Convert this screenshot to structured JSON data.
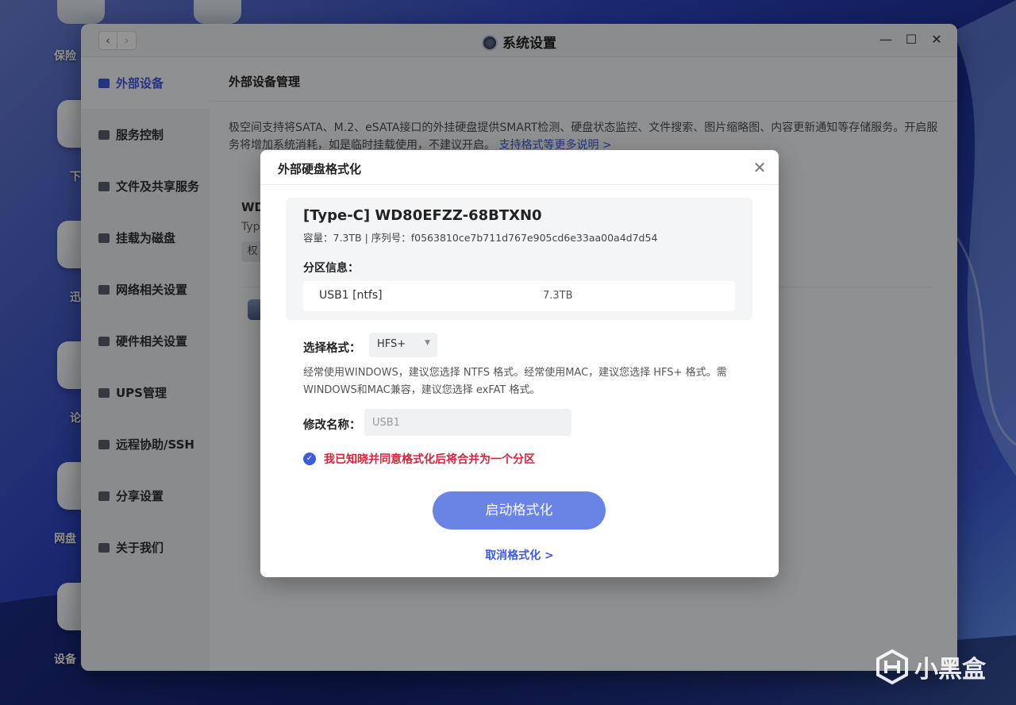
{
  "desktop": {
    "labels": [
      "保险",
      "下",
      "迅",
      "论",
      "网盘",
      "设备"
    ]
  },
  "window": {
    "title": "系统设置",
    "nav_back": "‹",
    "nav_forward": "›",
    "ctrl_min": "—",
    "ctrl_max": "☐",
    "ctrl_close": "✕"
  },
  "sidebar": {
    "items": [
      {
        "label": "外部设备",
        "icon": "device-icon"
      },
      {
        "label": "服务控制",
        "icon": "toggle-icon"
      },
      {
        "label": "文件及共享服务",
        "icon": "file-icon"
      },
      {
        "label": "挂载为磁盘",
        "icon": "disk-icon"
      },
      {
        "label": "网络相关设置",
        "icon": "globe-icon"
      },
      {
        "label": "硬件相关设置",
        "icon": "grid-icon"
      },
      {
        "label": "UPS管理",
        "icon": "battery-icon"
      },
      {
        "label": "远程协助/SSH",
        "icon": "monitor-icon"
      },
      {
        "label": "分享设置",
        "icon": "share-icon"
      },
      {
        "label": "关于我们",
        "icon": "info-icon"
      }
    ]
  },
  "content": {
    "header": "外部设备管理",
    "desc": "极空间支持将SATA、M.2、eSATA接口的外挂硬盘提供SMART检测、硬盘状态监控、文件搜索、图片缩略图、内容更新通知等存储服务。开启服务将增加系统消耗，如是临时挂载使用，不建议开启。",
    "desc_link": "支持格式等更多说明 >",
    "device_prefix": "WD",
    "device_sub": "Typ",
    "bg_button": "权"
  },
  "modal": {
    "title": "外部硬盘格式化",
    "close": "✕",
    "disk_name": "[Type-C] WD80EFZZ-68BTXN0",
    "disk_meta": "容量：7.3TB  |  序列号：f0563810ce7b711d767e905cd6e33aa00a4d7d54",
    "partition_label": "分区信息：",
    "partition": {
      "name": "USB1 [ntfs]",
      "size": "7.3TB"
    },
    "format_label": "选择格式：",
    "format_value": "HFS+",
    "hint": "经常使用WINDOWS，建议您选择 NTFS 格式。经常使用MAC，建议您选择 HFS+ 格式。需WINDOWS和MAC兼容，建议您选择 exFAT 格式。",
    "name_label": "修改名称：",
    "name_value": "USB1",
    "agree_text": "我已知晓并同意格式化后将合并为一个分区",
    "start_button": "启动格式化",
    "cancel_link": "取消格式化 >"
  },
  "watermark": "小黑盒",
  "colors": {
    "accent": "#3d5be0",
    "button": "#6a84e6",
    "warning": "#d6243a"
  }
}
